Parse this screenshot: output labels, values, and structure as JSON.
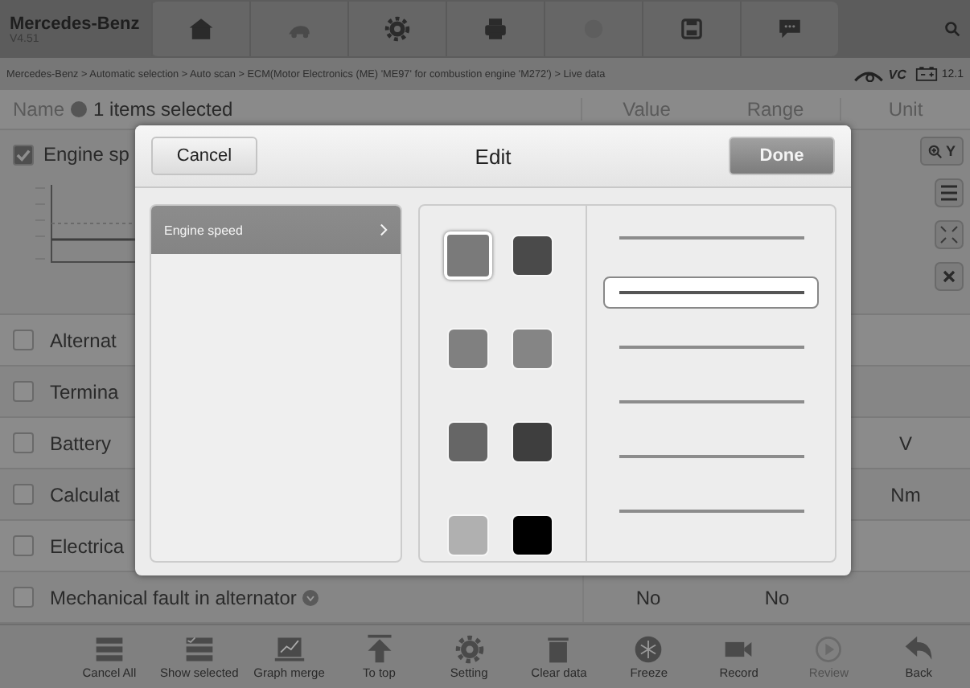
{
  "app": {
    "title": "Mercedes-Benz",
    "version": "V4.51"
  },
  "breadcrumb": "Mercedes-Benz > Automatic selection > Auto scan > ECM(Motor Electronics (ME) 'ME97' for combustion engine 'M272') > Live data",
  "status": {
    "vci": "VC",
    "battery": "12.1"
  },
  "columns": {
    "name": "Name",
    "selection": "1 items selected",
    "value": "Value",
    "range": "Range",
    "unit": "Unit"
  },
  "rows": [
    {
      "kind": "graph",
      "name": "Engine sp",
      "checked": true,
      "value": "",
      "range": "",
      "unit": ""
    },
    {
      "kind": "plain",
      "name": "Alternat",
      "checked": false,
      "value": "",
      "range": "",
      "unit": ""
    },
    {
      "kind": "plain",
      "name": "Termina",
      "checked": false,
      "value": "",
      "range": "",
      "unit": ""
    },
    {
      "kind": "plain",
      "name": "Battery",
      "checked": false,
      "value": "",
      "range": "",
      "unit": "V"
    },
    {
      "kind": "plain",
      "name": "Calculat",
      "checked": false,
      "value": "",
      "range": "",
      "unit": "Nm"
    },
    {
      "kind": "plain",
      "name": "Electrica",
      "checked": false,
      "value": "",
      "range": "",
      "unit": ""
    },
    {
      "kind": "info",
      "name": "Mechanical fault in alternator",
      "checked": false,
      "value": "No",
      "range": "No",
      "unit": ""
    }
  ],
  "graph_controls": {
    "zoom_y": "Y"
  },
  "dialog": {
    "title": "Edit",
    "cancel": "Cancel",
    "done": "Done",
    "items": [
      {
        "label": "Engine speed",
        "selected": true
      }
    ],
    "swatches": [
      {
        "color": "#7a7a7a",
        "selected": true
      },
      {
        "color": "#4a4a4a",
        "selected": false
      },
      {
        "color": "#808080",
        "selected": false
      },
      {
        "color": "#858585",
        "selected": false
      },
      {
        "color": "#666666",
        "selected": false
      },
      {
        "color": "#3e3e3e",
        "selected": false
      },
      {
        "color": "#b0b0b0",
        "selected": false
      },
      {
        "color": "#000000",
        "selected": false
      }
    ],
    "line_styles": [
      {
        "selected": false
      },
      {
        "selected": true
      },
      {
        "selected": false
      },
      {
        "selected": false
      },
      {
        "selected": false
      },
      {
        "selected": false
      }
    ]
  },
  "bottom_bar": [
    {
      "label": "Cancel All",
      "disabled": false
    },
    {
      "label": "Show selected",
      "disabled": false
    },
    {
      "label": "Graph merge",
      "disabled": false
    },
    {
      "label": "To top",
      "disabled": false
    },
    {
      "label": "Setting",
      "disabled": false
    },
    {
      "label": "Clear data",
      "disabled": false
    },
    {
      "label": "Freeze",
      "disabled": false
    },
    {
      "label": "Record",
      "disabled": false
    },
    {
      "label": "Review",
      "disabled": true
    },
    {
      "label": "Back",
      "disabled": false
    }
  ]
}
